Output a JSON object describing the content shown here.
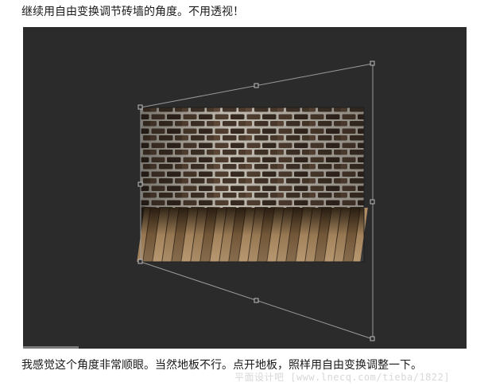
{
  "post": {
    "caption_top": "继续用自由变换调节砖墙的角度。不用透视！",
    "caption_bottom": "我感觉这个角度非常顺眼。当然地板不行。点开地板，照样用自由变换调整一下。",
    "watermark": "平面设计吧 [www.lnecq.com/tieba/1822]"
  },
  "canvas": {
    "background_color": "#2b2b2b",
    "transform_box_color": "#9a9a9a",
    "image_layer": "brick-wall-with-wooden-floor"
  }
}
